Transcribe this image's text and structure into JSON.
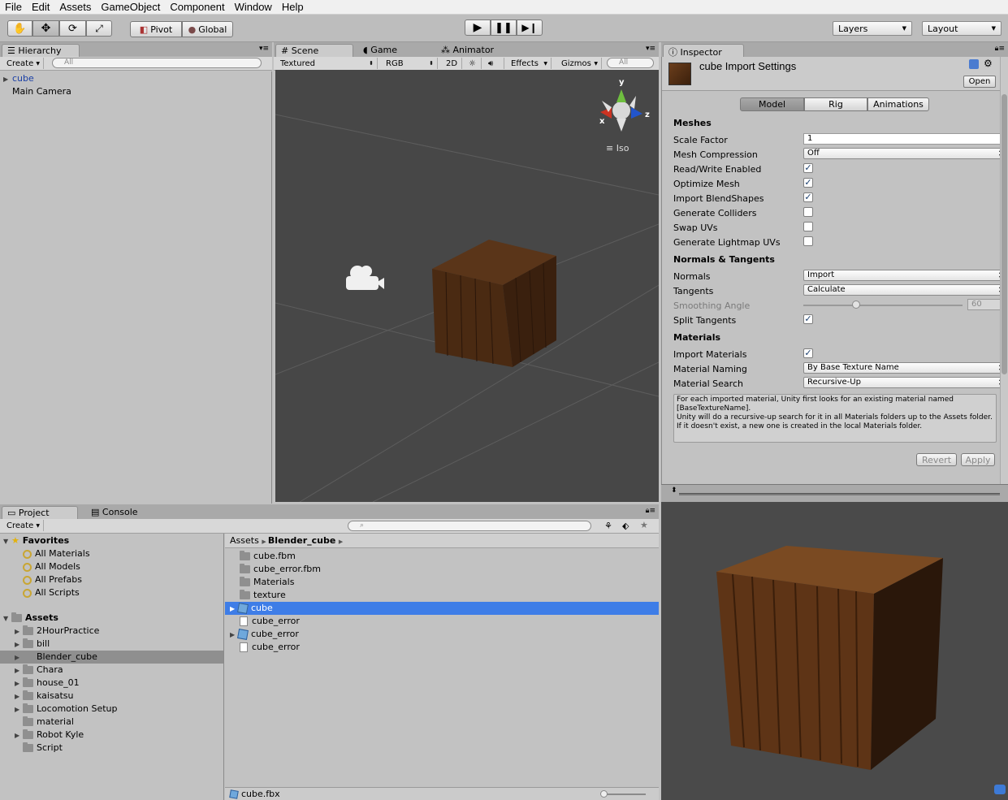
{
  "menu": [
    "File",
    "Edit",
    "Assets",
    "GameObject",
    "Component",
    "Window",
    "Help"
  ],
  "toolbar": {
    "pivot": "Pivot",
    "global": "Global",
    "layers": "Layers",
    "layout": "Layout"
  },
  "hierarchy": {
    "tab": "Hierarchy",
    "create": "Create",
    "search_placeholder": "All",
    "items": [
      "cube",
      "Main Camera"
    ]
  },
  "scene": {
    "tabs": [
      "Scene",
      "Game",
      "Animator"
    ],
    "shading": "Textured",
    "rgb": "RGB",
    "mode2d": "2D",
    "effects": "Effects",
    "gizmos": "Gizmos",
    "search_placeholder": "All",
    "iso": "Iso",
    "axes": {
      "x": "x",
      "y": "y",
      "z": "z"
    }
  },
  "inspector": {
    "tab": "Inspector",
    "title": "cube Import Settings",
    "open": "Open",
    "tabs": [
      "Model",
      "Rig",
      "Animations"
    ],
    "meshes_header": "Meshes",
    "scale_factor_label": "Scale Factor",
    "scale_factor": "1",
    "mesh_compression_label": "Mesh Compression",
    "mesh_compression": "Off",
    "read_write_label": "Read/Write Enabled",
    "optimize_mesh_label": "Optimize Mesh",
    "import_blendshapes_label": "Import BlendShapes",
    "generate_colliders_label": "Generate Colliders",
    "swap_uvs_label": "Swap UVs",
    "generate_lightmap_label": "Generate Lightmap UVs",
    "normals_header": "Normals & Tangents",
    "normals_label": "Normals",
    "normals": "Import",
    "tangents_label": "Tangents",
    "tangents": "Calculate",
    "smoothing_label": "Smoothing Angle",
    "smoothing_value": "60",
    "smoothing_fraction": 0.33,
    "split_tangents_label": "Split Tangents",
    "materials_header": "Materials",
    "import_materials_label": "Import Materials",
    "material_naming_label": "Material Naming",
    "material_naming": "By Base Texture Name",
    "material_search_label": "Material Search",
    "material_search": "Recursive-Up",
    "help_line1": "For each imported material, Unity first looks for an existing material named [BaseTextureName].",
    "help_line2": "Unity will do a recursive-up search for it in all Materials folders up to the Assets folder.",
    "help_line3": "If it doesn't exist, a new one is created in the local Materials folder.",
    "revert": "Revert",
    "apply": "Apply",
    "checkbox_glyph": "✓"
  },
  "project": {
    "tabs": [
      "Project",
      "Console"
    ],
    "create": "Create",
    "favorites_header": "Favorites",
    "favorites": [
      "All Materials",
      "All Models",
      "All Prefabs",
      "All Scripts"
    ],
    "assets_header": "Assets",
    "assets": [
      "2HourPractice",
      "bill",
      "Blender_cube",
      "Chara",
      "house_01",
      "kaisatsu",
      "Locomotion Setup",
      "material",
      "Robot Kyle",
      "Script"
    ],
    "breadcrumb_root": "Assets",
    "breadcrumb_current": "Blender_cube",
    "files": [
      "cube.fbm",
      "cube_error.fbm",
      "Materials",
      "texture",
      "cube",
      "cube_error",
      "cube_error",
      "cube_error"
    ],
    "status_file": "cube.fbx"
  }
}
